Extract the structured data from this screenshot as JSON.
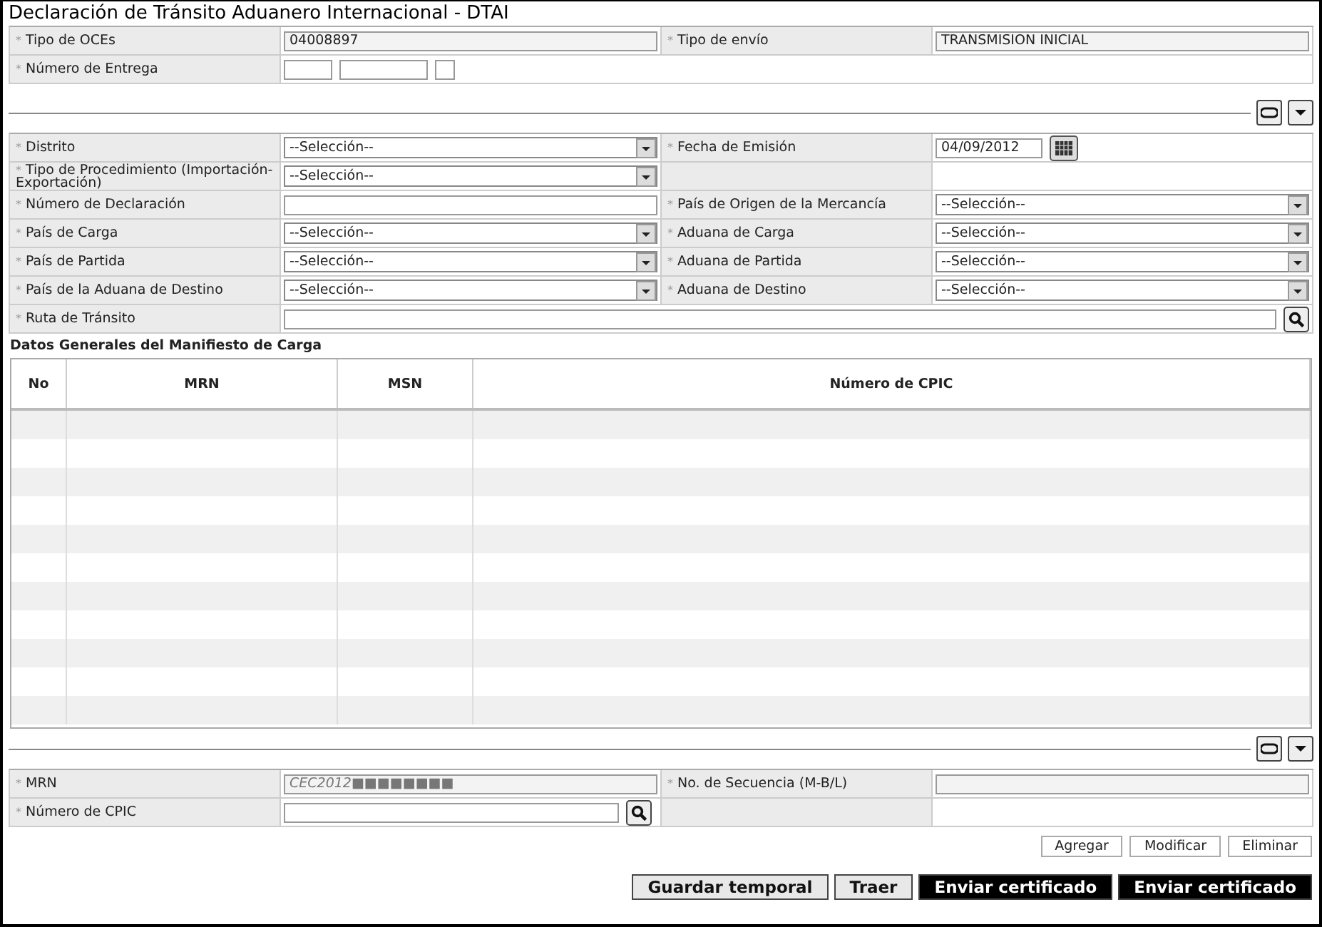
{
  "window": {
    "title": "Declaración de Tránsito Aduanero Internacional - DTAI"
  },
  "header_form": {
    "rows": [
      [
        {
          "mark": "*",
          "label": "Tipo de OCEs",
          "field": {
            "kind": "text",
            "readonly": true,
            "value": "04008897"
          }
        },
        {
          "mark": "*",
          "label": "Tipo de envío",
          "field": {
            "kind": "text",
            "readonly": true,
            "value": "TRANSMISION INICIAL"
          }
        }
      ],
      [
        {
          "mark": "*",
          "label": "Número de Entrega",
          "field": {
            "kind": "split"
          }
        }
      ]
    ]
  },
  "detail_form": {
    "rows": [
      [
        {
          "mark": "*",
          "label": "Distrito",
          "field": {
            "kind": "select",
            "value": "--Selección--"
          }
        },
        {
          "mark": "*",
          "label": "Fecha de Emisión",
          "field": {
            "kind": "date",
            "value": "04/09/2012"
          }
        }
      ],
      [
        {
          "mark": "*",
          "label": "Tipo de Procedimiento (Importación-Exportación)",
          "field": {
            "kind": "select",
            "value": "--Selección--"
          }
        },
        {
          "kind": "blank"
        }
      ],
      [
        {
          "mark": "*",
          "label": "Número de Declaración",
          "field": {
            "kind": "text",
            "readonly": false
          }
        },
        {
          "mark": "*",
          "label": "País de Origen de la Mercancía",
          "field": {
            "kind": "select",
            "value": "--Selección--"
          }
        }
      ],
      [
        {
          "mark": "*",
          "label": "País de Carga",
          "field": {
            "kind": "select",
            "value": "--Selección--"
          }
        },
        {
          "mark": "*",
          "label": "Aduana de Carga",
          "field": {
            "kind": "select",
            "value": "--Selección--"
          }
        }
      ],
      [
        {
          "mark": "*",
          "label": "País de Partida",
          "field": {
            "kind": "select",
            "value": "--Selección--"
          }
        },
        {
          "mark": "*",
          "label": "Aduana de Partida",
          "field": {
            "kind": "select",
            "value": "--Selección--"
          }
        }
      ],
      [
        {
          "mark": "*",
          "label": "País de la Aduana de Destino",
          "field": {
            "kind": "select",
            "value": "--Selección--"
          }
        },
        {
          "mark": "*",
          "label": "Aduana de Destino",
          "field": {
            "kind": "select",
            "value": "--Selección--"
          }
        }
      ],
      [
        {
          "mark": "*",
          "label": "Ruta de Tránsito",
          "field": {
            "kind": "search"
          }
        }
      ]
    ]
  },
  "manifest": {
    "title": "Datos Generales del Manifiesto de Carga",
    "columns": [
      "No",
      "MRN",
      "MSN",
      "Número de CPIC"
    ]
  },
  "item_form": {
    "rows": [
      [
        {
          "mark": "*",
          "label": "MRN",
          "field": {
            "kind": "text",
            "readonly": true,
            "italic": true,
            "value": "CEC2012■■■■■■■■"
          }
        },
        {
          "mark": "*",
          "label": "No. de Secuencia (M-B/L)",
          "field": {
            "kind": "text",
            "readonly": true
          }
        }
      ],
      [
        {
          "mark": "*",
          "label": "Número de CPIC",
          "field": {
            "kind": "search",
            "short": true
          }
        },
        {
          "kind": "blank"
        }
      ]
    ]
  },
  "item_buttons": [
    "Agregar",
    "Modificar",
    "Eliminar"
  ],
  "footer_buttons": [
    {
      "label": "Guardar temporal",
      "kind": "light"
    },
    {
      "label": "Traer",
      "kind": "light"
    },
    {
      "label": "Enviar certificado",
      "kind": "dark"
    },
    {
      "label": "Enviar certificado",
      "kind": "dark"
    }
  ]
}
